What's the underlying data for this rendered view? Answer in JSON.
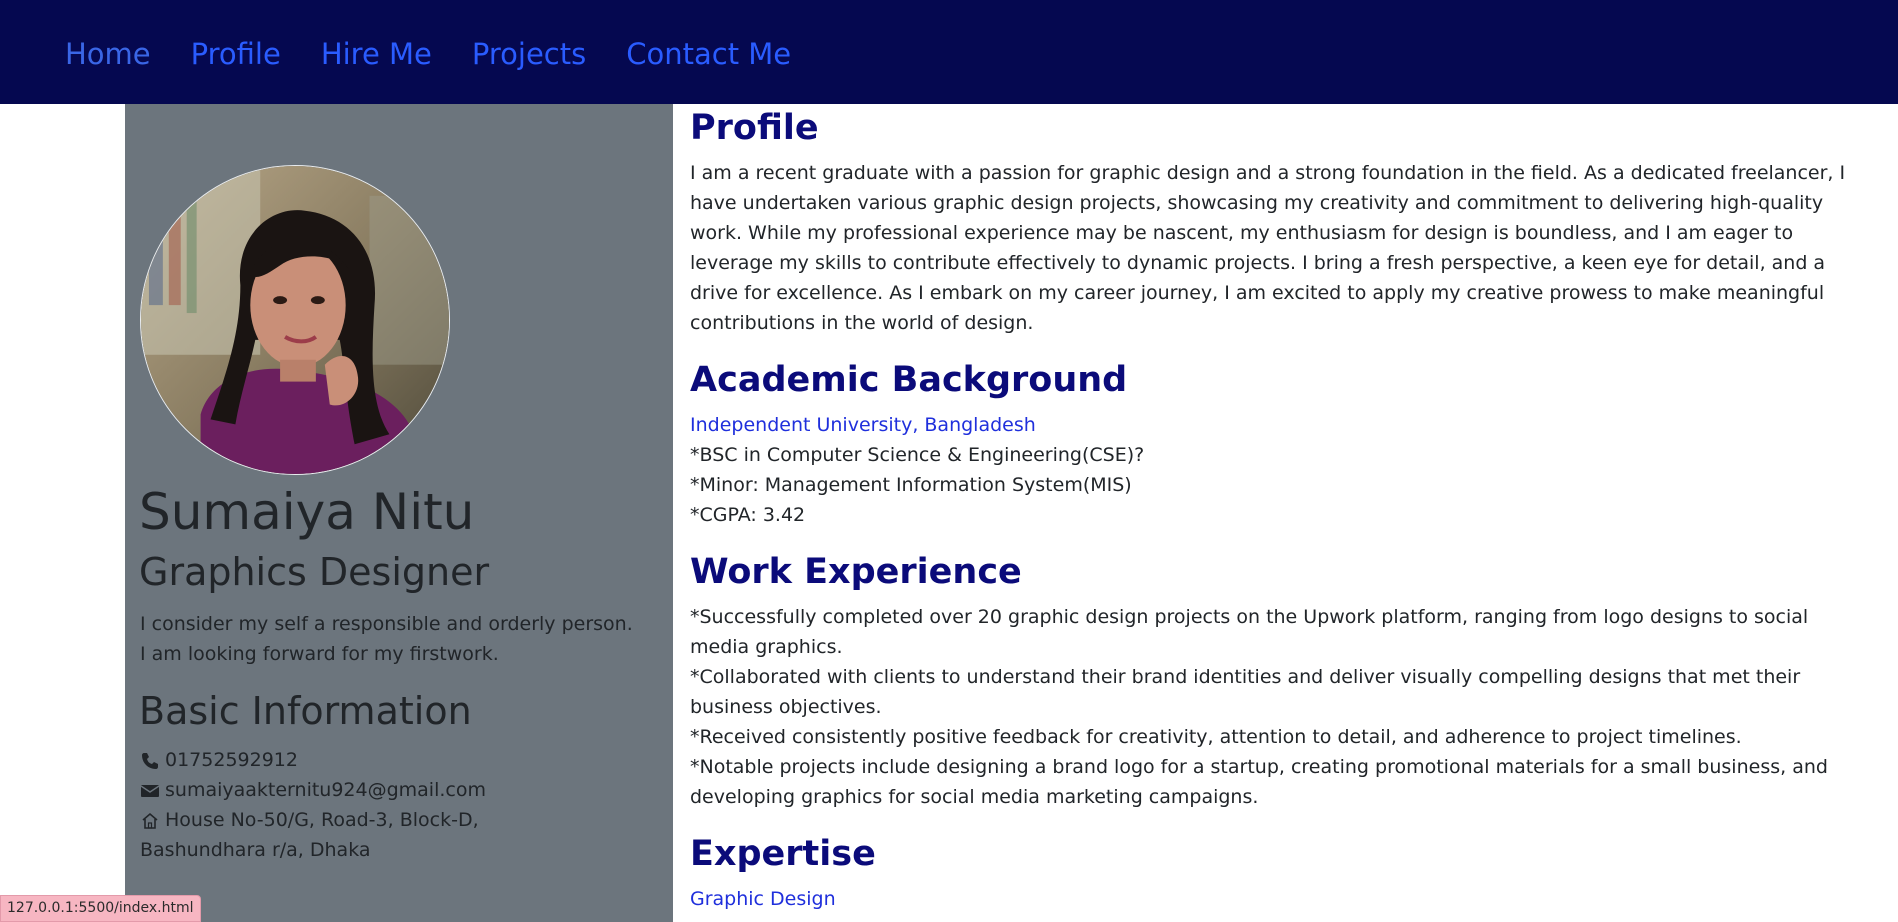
{
  "nav": {
    "items": [
      {
        "label": "Home",
        "active": true
      },
      {
        "label": "Profile"
      },
      {
        "label": "Hire Me"
      },
      {
        "label": "Projects"
      },
      {
        "label": "Contact Me"
      }
    ]
  },
  "sidebar": {
    "avatar_icon": "profile-photo",
    "name": "Sumaiya Nitu",
    "role": "Graphics Designer",
    "bio_line1": "I consider my self a responsible and orderly person.",
    "bio_line2": "I am looking forward for my firstwork.",
    "basic_title": "Basic Information",
    "phone": "01752592912",
    "email": "sumaiyaakternitu924@gmail.com",
    "address_line1": "House No-50/G, Road-3, Block-D,",
    "address_line2": "Bashundhara r/a, Dhaka"
  },
  "profile": {
    "title": "Profile",
    "lines": [
      "I am a recent graduate with a passion for graphic design and a strong foundation in the field. As a dedicated freelancer, I",
      "have undertaken various graphic design projects, showcasing my creativity and commitment to delivering high-quality",
      "work. While my professional experience may be nascent, my enthusiasm for design is boundless, and I am eager to",
      "leverage my skills to contribute effectively to dynamic projects. I bring a fresh perspective, a keen eye for detail, and a",
      "drive for excellence. As I embark on my career journey, I am excited to apply my creative prowess to make meaningful",
      "contributions in the world of design."
    ]
  },
  "academic": {
    "title": "Academic Background",
    "university": "Independent University, Bangladesh",
    "degree": "*BSC in Computer Science & Engineering(CSE)?",
    "minor": "*Minor: Management Information System(MIS)",
    "cgpa": "*CGPA: 3.42"
  },
  "work": {
    "title": "Work Experience",
    "lines": [
      "*Successfully completed over 20 graphic design projects on the Upwork platform, ranging from logo designs to social",
      "media graphics.",
      "*Collaborated with clients to understand their brand identities and deliver visually compelling designs that met their",
      "business objectives.",
      "*Received consistently positive feedback for creativity, attention to detail, and adherence to project timelines.",
      "*Notable projects include designing a brand logo for a startup, creating promotional materials for a small business, and",
      "developing graphics for social media marketing campaigns."
    ]
  },
  "expertise": {
    "title": "Expertise",
    "first_item": "Graphic Design"
  },
  "status_bar": {
    "url": "127.0.0.1:5500/index.html"
  },
  "colors": {
    "navbar_bg": "#050850",
    "nav_link": "#2a5cff",
    "sidebar_bg": "#6c757d",
    "heading": "#0b0b7a",
    "link_text": "#1f2fdc"
  }
}
